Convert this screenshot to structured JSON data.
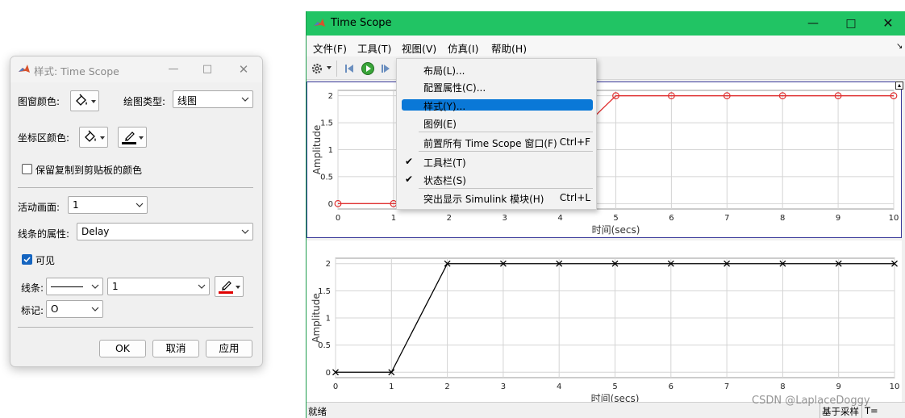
{
  "dialog": {
    "title": "样式: Time Scope",
    "figure_color_label": "图窗颜色:",
    "plot_type_label": "绘图类型:",
    "plot_type_value": "线图",
    "axes_color_label": "坐标区颜色:",
    "preserve_colors_label": "保留复制到剪贴板的颜色",
    "active_display_label": "活动画面:",
    "active_display_value": "1",
    "line_properties_label": "线条的属性:",
    "line_properties_value": "Delay",
    "visible_label": "可见",
    "line_label": "线条:",
    "line_width_value": "1",
    "marker_label": "标记:",
    "marker_value": "O",
    "ok_label": "OK",
    "cancel_label": "取消",
    "apply_label": "应用",
    "line_color": "#e00000"
  },
  "scope": {
    "title": "Time Scope",
    "accent": "#21c464",
    "menu": [
      "文件(F)",
      "工具(T)",
      "视图(V)",
      "仿真(I)",
      "帮助(H)"
    ],
    "status_left": "就绪",
    "status_right": "基于采样",
    "status_extra": "T="
  },
  "view_menu": {
    "items": [
      {
        "label": "布局(L)..."
      },
      {
        "label": "配置属性(C)..."
      },
      {
        "label": "样式(Y)..."
      },
      {
        "label": "图例(E)"
      },
      {
        "label": "前置所有 Time Scope 窗口(F)",
        "shortcut": "Ctrl+F"
      },
      {
        "label": "工具栏(T)",
        "check": "✔"
      },
      {
        "label": "状态栏(S)",
        "check": "✔"
      },
      {
        "label": "突出显示 Simulink 模块(H)",
        "shortcut": "Ctrl+L"
      }
    ]
  },
  "chart_data": [
    {
      "type": "line",
      "xlabel": "时间(secs)",
      "ylabel": "Amplitude",
      "xlim": [
        0,
        10
      ],
      "ylim": [
        -0.1,
        2.1
      ],
      "xticks": [
        "0",
        "1",
        "2",
        "3",
        "4",
        "5",
        "6",
        "7",
        "8",
        "9",
        "10"
      ],
      "yticks": [
        "0",
        "0.5",
        "1",
        "1.5",
        "2"
      ],
      "grid": true,
      "color": "#e03030",
      "marker": "circle",
      "x": [
        0,
        1,
        2,
        3,
        4,
        5,
        6,
        7,
        8,
        9,
        10
      ],
      "y": [
        0,
        0,
        0,
        0,
        1,
        2,
        2,
        2,
        2,
        2,
        2
      ]
    },
    {
      "type": "line",
      "xlabel": "时间(secs)",
      "ylabel": "Amplitude",
      "xlim": [
        0,
        10
      ],
      "ylim": [
        -0.1,
        2.1
      ],
      "xticks": [
        "0",
        "1",
        "2",
        "3",
        "4",
        "5",
        "6",
        "7",
        "8",
        "9",
        "10"
      ],
      "yticks": [
        "0",
        "0.5",
        "1",
        "1.5",
        "2"
      ],
      "grid": true,
      "color": "#000000",
      "marker": "x",
      "x": [
        0,
        1,
        2,
        3,
        4,
        5,
        6,
        7,
        8,
        9,
        10
      ],
      "y": [
        0,
        0,
        2,
        2,
        2,
        2,
        2,
        2,
        2,
        2,
        2
      ]
    }
  ],
  "watermark": "CSDN @LaplaceDoggy"
}
